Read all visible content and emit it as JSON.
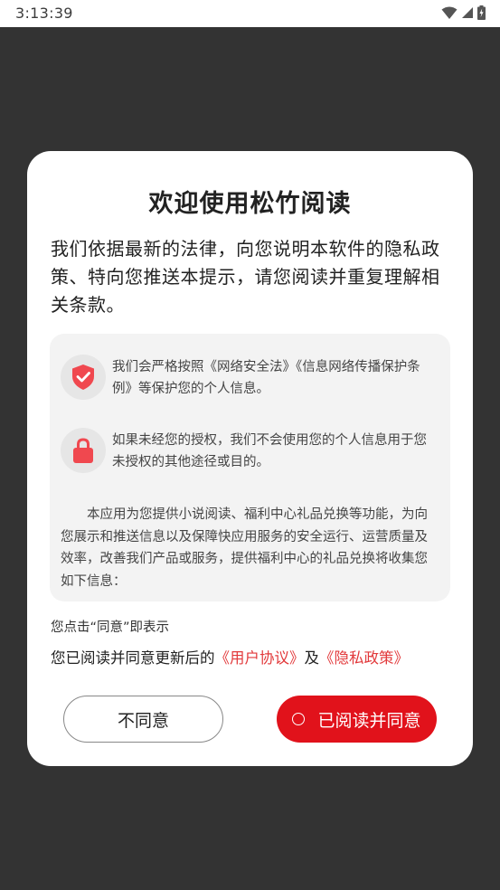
{
  "status_bar": {
    "time": "3:13:39"
  },
  "dialog": {
    "title": "欢迎使用松竹阅读",
    "intro": "我们依据最新的法律，向您说明本软件的隐私政策、特向您推送本提示，请您阅读并重复理解相关条款。",
    "info_items": [
      {
        "icon": "shield-check-icon",
        "text": "我们会严格按照《网络安全法》《信息网络传播保护条例》等保护您的个人信息。"
      },
      {
        "icon": "lock-icon",
        "text": "如果未经您的授权，我们不会使用您的个人信息用于您未授权的其他途径或目的。"
      }
    ],
    "description": "本应用为您提供小说阅读、福利中心礼品兑换等功能，为向您展示和推送信息以及保障快应用服务的安全运行、运营质量及效率，改善我们产品或服务，提供福利中心的礼品兑换将收集您如下信息：",
    "notice_line1": "您点击“同意”即表示",
    "notice_prefix": "您已阅读并同意更新后的",
    "user_agreement_link": "《用户协议》",
    "notice_and": "及",
    "privacy_policy_link": "《隐私政策》",
    "disagree_label": "不同意",
    "agree_label": "已阅读并同意"
  },
  "colors": {
    "accent": "#e1121b",
    "link": "#e2393b",
    "icon": "#f0484f",
    "overlay": "#333333"
  }
}
